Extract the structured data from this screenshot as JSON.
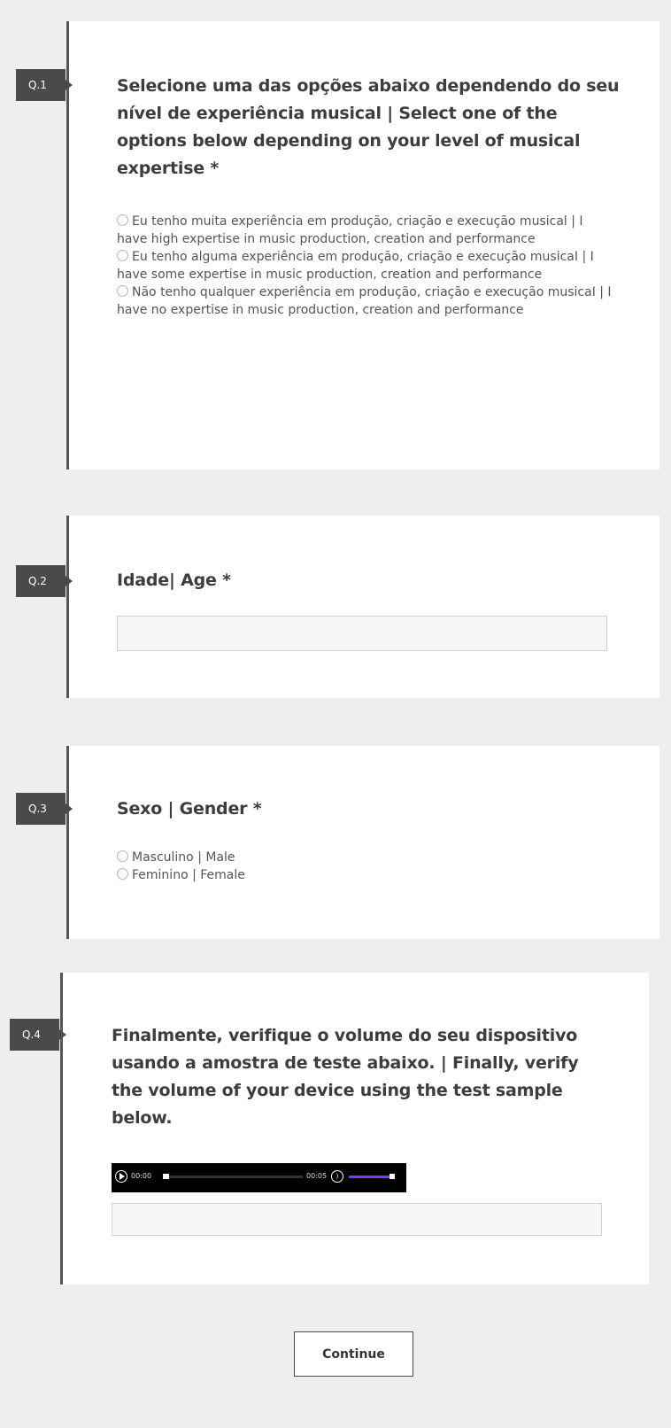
{
  "questions": [
    {
      "tag": "Q.1",
      "title": "Selecione uma das opções abaixo dependendo do seu nível de experiência musical | Select one of the options below depending on your level of musical expertise *",
      "options": [
        "Eu tenho muita experiência em produção, criação e execução musical | I have high expertise in music production, creation and performance",
        "Eu tenho alguma experiência em produção, criação e execução musicaI | I have some expertise in music production, creation and performance",
        "Não tenho qualquer experiência em produção, criação e execução musicaI | I have no expertise in music production, creation and performance"
      ]
    },
    {
      "tag": "Q.2",
      "title": "Idade| Age *",
      "input_value": ""
    },
    {
      "tag": "Q.3",
      "title": "Sexo | Gender *",
      "options": [
        "Masculino | Male",
        "Feminino | Female"
      ]
    },
    {
      "tag": "Q.4",
      "title": "Finalmente, verifique o volume do seu dispositivo usando a amostra de teste abaixo. | Finally, verify the volume of your device using the test sample below.",
      "player": {
        "current_time": "00:00",
        "duration": "00:05",
        "progress": 0,
        "volume": 1.0,
        "volume_color": "#7a3cf0"
      },
      "input_value": ""
    }
  ],
  "continue_label": "Continue"
}
